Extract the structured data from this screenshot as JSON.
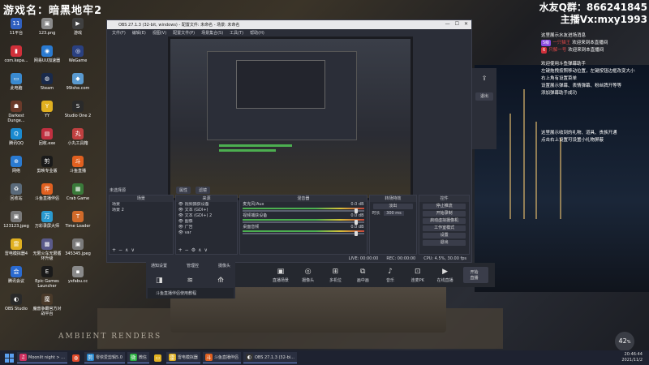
{
  "overlay": {
    "game_name": "游戏名：暗黑地牢2",
    "qq_group": "水友Q群：866241845",
    "host_vx": "主播Vx:mxy1993",
    "scene_watermark": "AMBIENT RENDERS"
  },
  "desktop_icons": [
    {
      "label": "11平台",
      "glyph": "11",
      "color": "#3060c0"
    },
    {
      "label": "123.png",
      "glyph": "▣",
      "color": "#8a8a8a"
    },
    {
      "label": "游戏",
      "glyph": "▶",
      "color": "#404040"
    },
    {
      "label": "com.kepa...",
      "glyph": "▮",
      "color": "#d0303a"
    },
    {
      "label": "网易UU加速器",
      "glyph": "◉",
      "color": "#2a7ad0"
    },
    {
      "label": "WeGame",
      "glyph": "◎",
      "color": "#2a4080"
    },
    {
      "label": "此电脑",
      "glyph": "▭",
      "color": "#3a8ad0"
    },
    {
      "label": "Steam",
      "glyph": "◍",
      "color": "#1a2a4a"
    },
    {
      "label": "99ishe.com",
      "glyph": "◆",
      "color": "#5a9ad0"
    },
    {
      "label": "Darkest Dunge...",
      "glyph": "☗",
      "color": "#6a3a2a"
    },
    {
      "label": "YY",
      "glyph": "Y",
      "color": "#e0b020"
    },
    {
      "label": "Studio One 2",
      "glyph": "S",
      "color": "#2a2a2a"
    },
    {
      "label": "腾讯QQ",
      "glyph": "Q",
      "color": "#1a8ad0"
    },
    {
      "label": "回收.exe",
      "glyph": "▤",
      "color": "#c03040"
    },
    {
      "label": "小丸工具箱",
      "glyph": "丸",
      "color": "#c04040"
    },
    {
      "label": "网络",
      "glyph": "⊕",
      "color": "#2a7ad0"
    },
    {
      "label": "剪映专业版",
      "glyph": "剪",
      "color": "#1a1a1a"
    },
    {
      "label": "斗鱼直播",
      "glyph": "斗",
      "color": "#e06020"
    },
    {
      "label": "回收站",
      "glyph": "♻",
      "color": "#5a6a7a"
    },
    {
      "label": "斗鱼直播伴侣",
      "glyph": "伴",
      "color": "#e06020"
    },
    {
      "label": "Crab Game",
      "glyph": "▦",
      "color": "#3a7a3a"
    },
    {
      "label": "123123.jpeg",
      "glyph": "▣",
      "color": "#7a7a7a"
    },
    {
      "label": "万彩录屏大师",
      "glyph": "万",
      "color": "#2a9ad0"
    },
    {
      "label": "Time Loader",
      "glyph": "T",
      "color": "#d06a2a"
    },
    {
      "label": "雷电模拟器4",
      "glyph": "雷",
      "color": "#e0b020"
    },
    {
      "label": "无限火车无限循环升级",
      "glyph": "▩",
      "color": "#5a5a8a"
    },
    {
      "label": "345345.jpeg",
      "glyph": "▣",
      "color": "#7a7a7a"
    },
    {
      "label": "腾讯会议",
      "glyph": "会",
      "color": "#2a6ad0"
    },
    {
      "label": "Epic Games Launcher",
      "glyph": "E",
      "color": "#1a1a1a"
    },
    {
      "label": "yxfabu.cc",
      "glyph": "▪",
      "color": "#8a8a8a"
    },
    {
      "label": "OBS Studio",
      "glyph": "◐",
      "color": "#2a2a2a"
    },
    {
      "label": "魔兽争霸官方对战平台",
      "glyph": "魔",
      "color": "#4a3a2a"
    }
  ],
  "obs": {
    "title": "OBS 27.1.3 (32-bit, windows) - 配置文件: 未命名 - 场景: 未命名",
    "menu": [
      "文件(F)",
      "编辑(E)",
      "视图(V)",
      "配置文件(P)",
      "场景集合(S)",
      "工具(T)",
      "帮助(H)"
    ],
    "no_source_selected": "未选择源",
    "props_button": "属性",
    "filters_button": "滤镜",
    "scenes_header": "场景",
    "scenes": [
      "场景",
      "场景 2"
    ],
    "sources_header": "来源",
    "sources": [
      "视频捕获设备",
      "文本 (GDI+)",
      "文本 (GDI+) 2",
      "图像",
      "广告",
      "var"
    ],
    "mixer_header": "混音器",
    "mixer": [
      {
        "name": "麦克风/Aux",
        "db": "0.0 dB"
      },
      {
        "name": "视频捕获设备",
        "db": "0.0 dB"
      },
      {
        "name": "桌面音频",
        "db": "0.0 dB"
      }
    ],
    "transitions_header": "转场特效",
    "transition_type": "淡出",
    "duration_label": "时长",
    "duration_value": "300 ms",
    "controls_header": "控件",
    "controls": [
      "停止推流",
      "开始录制",
      "启动虚拟摄像机",
      "工作室模式",
      "设置",
      "退出"
    ],
    "status": {
      "live": "LIVE: 00:00:00",
      "rec": "REC: 00:00:00",
      "cpu": "CPU: 4.5%, 30.00 fps"
    }
  },
  "live_panel": {
    "share_icon": "share-icon",
    "exit_label": "退出"
  },
  "bottom_tools": {
    "tabs": [
      "通知设置",
      "管理控",
      "摄像头"
    ],
    "note": "斗鱼直播伴侣使用教程",
    "tools": [
      "直播场景",
      "摄像头",
      "多机位",
      "画中画",
      "音乐",
      "连麦PK",
      "在线直播"
    ],
    "right_button": "开始直播"
  },
  "chat": {
    "system1": "这里展示水友进场消息",
    "u1_badge": "5级",
    "u1_name": "一只猫王",
    "u1_text": "欢迎来到本直播间",
    "u2_badge": "6",
    "u2_name": "只解一号",
    "u2_text": "欢迎来到本直播间",
    "welcome": [
      "欢迎使用斗鱼弹幕助手",
      "左键拖拽按照移动位置，左键按钮边框改变大小",
      "右上角有设置菜单",
      "设置展示弹幕、表情弹幕、粉丝牌开等等",
      "添加弹幕助手成功"
    ],
    "system2": [
      "这里展示收到的礼物、道具、贵族开通",
      "点击右上设置可设置小礼物屏蔽"
    ]
  },
  "rate": {
    "value": "42",
    "unit": "%"
  },
  "taskbar": {
    "items": [
      {
        "label": "Moonlit night > ...",
        "glyph": "♫",
        "color": "#d03060"
      },
      {
        "label": "",
        "glyph": "◍",
        "color": "#e04a2a"
      },
      {
        "label": "零依爱剪辑5.0",
        "glyph": "剪",
        "color": "#2a8ad0"
      },
      {
        "label": "微信",
        "glyph": "微",
        "color": "#2ab040"
      },
      {
        "label": "",
        "glyph": "▭",
        "color": "#e0b020"
      },
      {
        "label": "雷电模拟器",
        "glyph": "雷",
        "color": "#e0b020"
      },
      {
        "label": "斗鱼直播伴侣",
        "glyph": "斗",
        "color": "#e06020"
      },
      {
        "label": "OBS 27.1.3 (32-bi...",
        "glyph": "◐",
        "color": "#333"
      }
    ],
    "time": "20:46:44",
    "date": "2021/11/2"
  },
  "colors": {
    "accent": "#4caf50",
    "obs_bg": "#2b2e38",
    "chat_user": "#e04848"
  }
}
